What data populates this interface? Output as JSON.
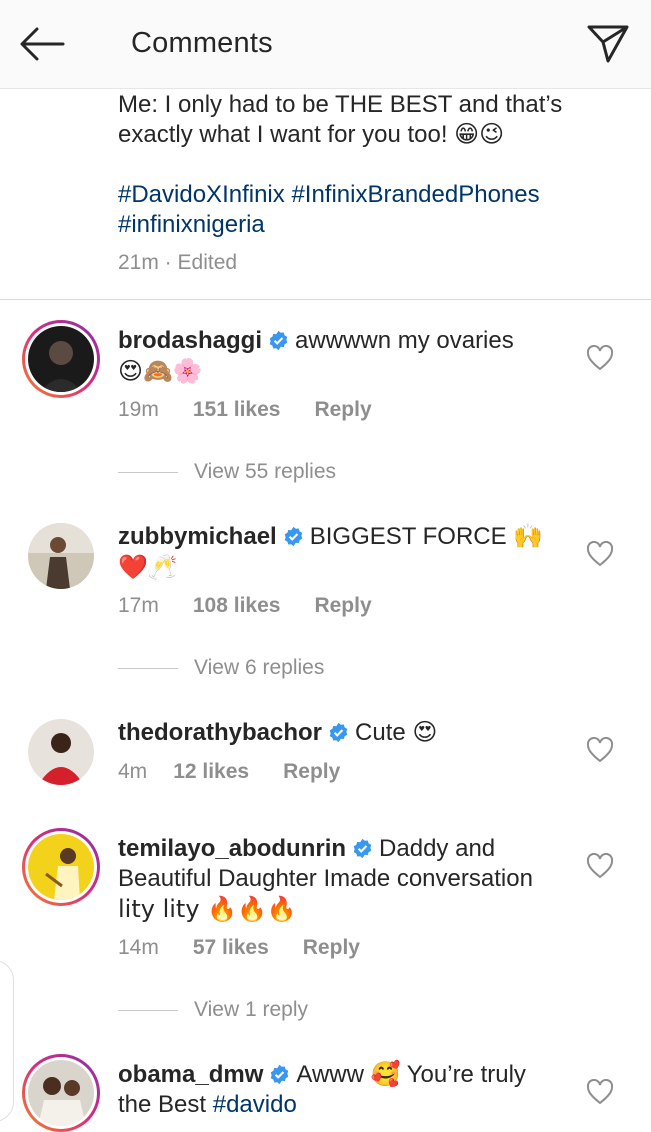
{
  "header": {
    "title": "Comments"
  },
  "caption": {
    "line1": "Me: I only had to be THE BEST and that’s",
    "line2": "exactly what I want for you too! 😁😉",
    "hashtags": [
      "#DavidoXInfinix",
      "#InfinixBrandedPhones",
      "#infinixnigeria"
    ],
    "meta": "21m · Edited"
  },
  "comments": [
    {
      "username": "brodashaggi",
      "text": "awwwwn my ovaries",
      "text2": "😍🙈🌸",
      "time": "19m",
      "likes": "151 likes",
      "reply": "Reply",
      "view_replies": "View 55 replies"
    },
    {
      "username": "zubbymichael",
      "text": "BIGGEST FORCE 🙌",
      "text2": "❤️🥂",
      "time": "17m",
      "likes": "108 likes",
      "reply": "Reply",
      "view_replies": "View 6 replies"
    },
    {
      "username": "thedorathybachor",
      "text": "Cute 😍",
      "time": "4m",
      "likes": "12 likes",
      "reply": "Reply"
    },
    {
      "username": "temilayo_abodunrin",
      "text": "Daddy and",
      "text2": "Beautiful Daughter Imade conversation",
      "text3": "lity lity 🔥🔥🔥",
      "time": "14m",
      "likes": "57 likes",
      "reply": "Reply",
      "view_replies": "View 1 reply"
    },
    {
      "username": "obama_dmw",
      "text": "Awww 🥰 You’re truly",
      "text2": "the Best ",
      "tag": "#davido"
    }
  ],
  "colors": {
    "hashtag": "#003569",
    "verified": "#3897f0",
    "muted": "#8e8e8e",
    "text": "#262626"
  },
  "icons": [
    "back-arrow-icon",
    "send-icon",
    "verified-badge-icon",
    "heart-outline-icon"
  ]
}
